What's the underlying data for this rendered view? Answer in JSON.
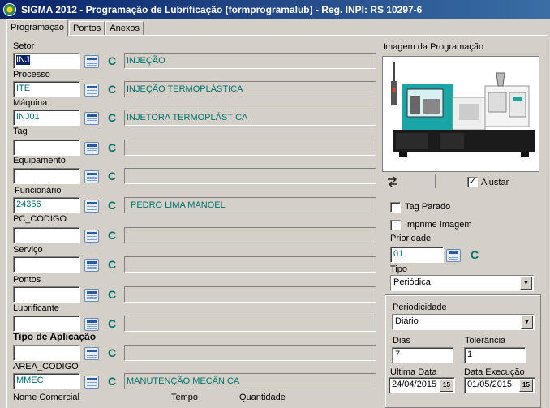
{
  "window": {
    "title": "SIGMA 2012 - Programação de Lubrificação  (formprogramalub)  - Reg. INPI: RS 10297-6"
  },
  "tabs": [
    {
      "label": "Programação"
    },
    {
      "label": "Pontos"
    },
    {
      "label": "Anexos"
    }
  ],
  "fields": {
    "setor": {
      "label": "Setor",
      "code": "INJ",
      "desc": "INJEÇÃO"
    },
    "processo": {
      "label": "Processo",
      "code": "ITE",
      "desc": "INJEÇÃO TERMOPLÁSTICA"
    },
    "maquina": {
      "label": "Máquina",
      "code": "INJ01",
      "desc": "INJETORA TERMOPLÁSTICA"
    },
    "tag": {
      "label": "Tag",
      "code": "",
      "desc": ""
    },
    "equipamento": {
      "label": "Equipamento",
      "code": "",
      "desc": ""
    },
    "funcionario": {
      "label": "Funcionário",
      "code": "24356",
      "desc": "PEDRO LIMA MANOEL"
    },
    "pc_codigo": {
      "label": "PC_CODIGO",
      "code": "",
      "desc": ""
    },
    "servico": {
      "label": "Serviço",
      "code": "",
      "desc": ""
    },
    "pontos": {
      "label": "Pontos",
      "code": "",
      "desc": ""
    },
    "lubrificante": {
      "label": "Lubrificante",
      "code": "",
      "desc": ""
    },
    "tipo_aplicacao": {
      "label": "Tipo de Aplicação",
      "code": "",
      "desc": ""
    },
    "area_codigo": {
      "label": "AREA_CODIGO",
      "code": "MMEC",
      "desc": "MANUTENÇÃO MECÂNICA"
    }
  },
  "clear_glyph": "C",
  "bottom_labels": {
    "nome_comercial": "Nome Comercial",
    "tempo": "Tempo",
    "quantidade": "Quantidade"
  },
  "image_panel": {
    "label": "Imagem da Programação",
    "ajustar_label": "Ajustar",
    "ajustar_checked": true
  },
  "options": {
    "tag_parado": {
      "label": "Tag Parado",
      "checked": false
    },
    "imprime_imagem": {
      "label": "Imprime Imagem",
      "checked": false
    }
  },
  "prioridade": {
    "label": "Prioridade",
    "value": "01"
  },
  "tipo": {
    "label": "Tipo",
    "value": "Periódica"
  },
  "periodicidade": {
    "label": "Periodicidade",
    "value": "Diário"
  },
  "dias": {
    "label": "Dias",
    "value": "7"
  },
  "tolerancia": {
    "label": "Tolerância",
    "value": "1"
  },
  "ultima_data": {
    "label": "Última Data",
    "value": "24/04/2015",
    "btn": "15"
  },
  "data_execucao": {
    "label": "Data Execução",
    "value": "01/05/2015",
    "btn": "15"
  }
}
